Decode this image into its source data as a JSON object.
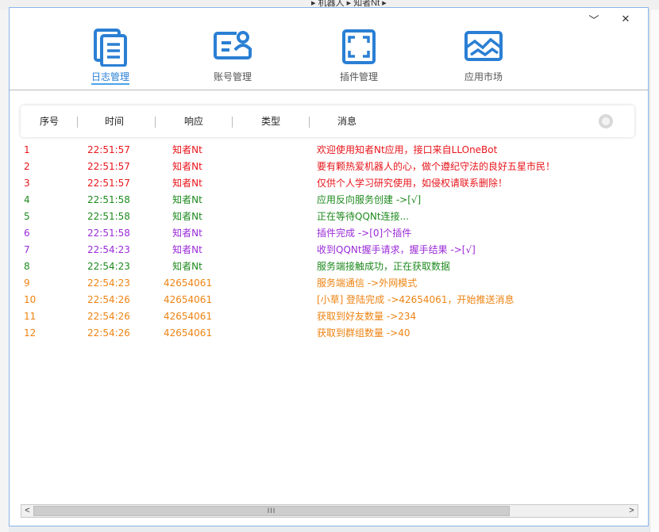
{
  "background": {
    "address": "▸ 机器人 ▸ 知者Nt ▸"
  },
  "window": {
    "minimize": "﹀",
    "close": "✕"
  },
  "nav": [
    {
      "label": "日志管理",
      "icon": "document-icon",
      "active": true
    },
    {
      "label": "账号管理",
      "icon": "account-card-icon",
      "active": false
    },
    {
      "label": "插件管理",
      "icon": "fullscreen-icon",
      "active": false
    },
    {
      "label": "应用市场",
      "icon": "image-icon",
      "active": false
    }
  ],
  "columns": [
    "序号",
    "时间",
    "响应",
    "类型",
    "消息"
  ],
  "colors": {
    "red": "#e8151b",
    "green": "#1f8a1f",
    "purple": "#9a2bd8",
    "orange": "#ee8312",
    "accent": "#2a7fd4"
  },
  "logs": [
    {
      "idx": "1",
      "time": "22:51:57",
      "resp": "知者Nt",
      "msg": "欢迎使用知者Nt应用，接口来自LLOneBot",
      "color": "red"
    },
    {
      "idx": "2",
      "time": "22:51:57",
      "resp": "知者Nt",
      "msg": "要有颗热爱机器人的心，做个遵纪守法的良好五星市民！",
      "color": "red"
    },
    {
      "idx": "3",
      "time": "22:51:57",
      "resp": "知者Nt",
      "msg": "仅供个人学习研究使用，如侵权请联系删除！",
      "color": "red"
    },
    {
      "idx": "4",
      "time": "22:51:58",
      "resp": "知者Nt",
      "msg": "应用反向服务创建 ->[√]",
      "color": "green"
    },
    {
      "idx": "5",
      "time": "22:51:58",
      "resp": "知者Nt",
      "msg": "正在等待QQNt连接...",
      "color": "green"
    },
    {
      "idx": "6",
      "time": "22:51:58",
      "resp": "知者Nt",
      "msg": "插件完成 ->[0]个插件",
      "color": "purple"
    },
    {
      "idx": "7",
      "time": "22:54:23",
      "resp": "知者Nt",
      "msg": "收到QQNt握手请求，握手结果 ->[√]",
      "color": "purple"
    },
    {
      "idx": "8",
      "time": "22:54:23",
      "resp": "知者Nt",
      "msg": "服务端接触成功，正在获取数据",
      "color": "green"
    },
    {
      "idx": "9",
      "time": "22:54:23",
      "resp": "42654061",
      "msg": "服务端通信 ->外网模式",
      "color": "orange"
    },
    {
      "idx": "10",
      "time": "22:54:26",
      "resp": "42654061",
      "msg": "[小草] 登陆完成 ->42654061，开始推送消息",
      "color": "orange"
    },
    {
      "idx": "11",
      "time": "22:54:26",
      "resp": "42654061",
      "msg": "获取到好友数量 ->234",
      "color": "orange"
    },
    {
      "idx": "12",
      "time": "22:54:26",
      "resp": "42654061",
      "msg": "获取到群组数量 ->40",
      "color": "orange"
    }
  ],
  "scrollbar": {
    "left": "<",
    "right": ">",
    "grip": "III"
  }
}
